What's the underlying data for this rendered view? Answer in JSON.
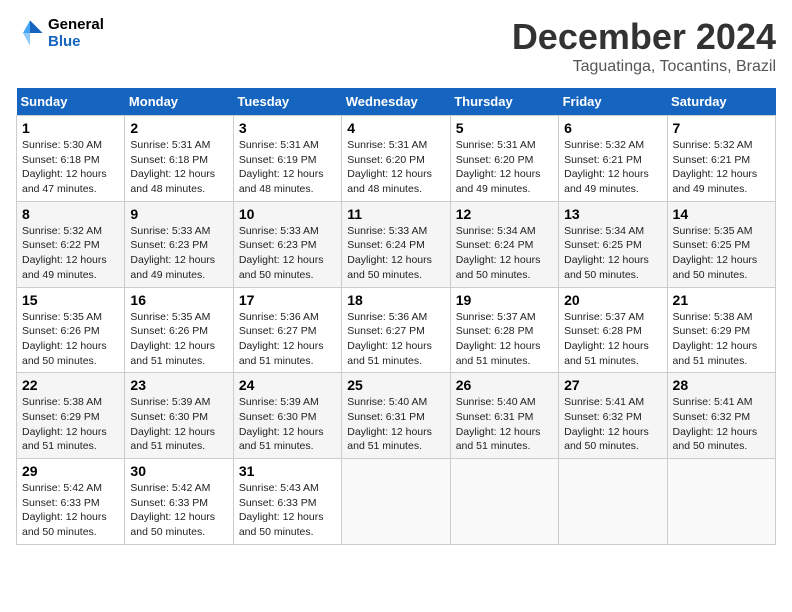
{
  "header": {
    "logo_line1": "General",
    "logo_line2": "Blue",
    "month": "December 2024",
    "location": "Taguatinga, Tocantins, Brazil"
  },
  "weekdays": [
    "Sunday",
    "Monday",
    "Tuesday",
    "Wednesday",
    "Thursday",
    "Friday",
    "Saturday"
  ],
  "weeks": [
    [
      {
        "day": "1",
        "sunrise": "Sunrise: 5:30 AM",
        "sunset": "Sunset: 6:18 PM",
        "daylight": "Daylight: 12 hours and 47 minutes."
      },
      {
        "day": "2",
        "sunrise": "Sunrise: 5:31 AM",
        "sunset": "Sunset: 6:18 PM",
        "daylight": "Daylight: 12 hours and 48 minutes."
      },
      {
        "day": "3",
        "sunrise": "Sunrise: 5:31 AM",
        "sunset": "Sunset: 6:19 PM",
        "daylight": "Daylight: 12 hours and 48 minutes."
      },
      {
        "day": "4",
        "sunrise": "Sunrise: 5:31 AM",
        "sunset": "Sunset: 6:20 PM",
        "daylight": "Daylight: 12 hours and 48 minutes."
      },
      {
        "day": "5",
        "sunrise": "Sunrise: 5:31 AM",
        "sunset": "Sunset: 6:20 PM",
        "daylight": "Daylight: 12 hours and 49 minutes."
      },
      {
        "day": "6",
        "sunrise": "Sunrise: 5:32 AM",
        "sunset": "Sunset: 6:21 PM",
        "daylight": "Daylight: 12 hours and 49 minutes."
      },
      {
        "day": "7",
        "sunrise": "Sunrise: 5:32 AM",
        "sunset": "Sunset: 6:21 PM",
        "daylight": "Daylight: 12 hours and 49 minutes."
      }
    ],
    [
      {
        "day": "8",
        "sunrise": "Sunrise: 5:32 AM",
        "sunset": "Sunset: 6:22 PM",
        "daylight": "Daylight: 12 hours and 49 minutes."
      },
      {
        "day": "9",
        "sunrise": "Sunrise: 5:33 AM",
        "sunset": "Sunset: 6:23 PM",
        "daylight": "Daylight: 12 hours and 49 minutes."
      },
      {
        "day": "10",
        "sunrise": "Sunrise: 5:33 AM",
        "sunset": "Sunset: 6:23 PM",
        "daylight": "Daylight: 12 hours and 50 minutes."
      },
      {
        "day": "11",
        "sunrise": "Sunrise: 5:33 AM",
        "sunset": "Sunset: 6:24 PM",
        "daylight": "Daylight: 12 hours and 50 minutes."
      },
      {
        "day": "12",
        "sunrise": "Sunrise: 5:34 AM",
        "sunset": "Sunset: 6:24 PM",
        "daylight": "Daylight: 12 hours and 50 minutes."
      },
      {
        "day": "13",
        "sunrise": "Sunrise: 5:34 AM",
        "sunset": "Sunset: 6:25 PM",
        "daylight": "Daylight: 12 hours and 50 minutes."
      },
      {
        "day": "14",
        "sunrise": "Sunrise: 5:35 AM",
        "sunset": "Sunset: 6:25 PM",
        "daylight": "Daylight: 12 hours and 50 minutes."
      }
    ],
    [
      {
        "day": "15",
        "sunrise": "Sunrise: 5:35 AM",
        "sunset": "Sunset: 6:26 PM",
        "daylight": "Daylight: 12 hours and 50 minutes."
      },
      {
        "day": "16",
        "sunrise": "Sunrise: 5:35 AM",
        "sunset": "Sunset: 6:26 PM",
        "daylight": "Daylight: 12 hours and 51 minutes."
      },
      {
        "day": "17",
        "sunrise": "Sunrise: 5:36 AM",
        "sunset": "Sunset: 6:27 PM",
        "daylight": "Daylight: 12 hours and 51 minutes."
      },
      {
        "day": "18",
        "sunrise": "Sunrise: 5:36 AM",
        "sunset": "Sunset: 6:27 PM",
        "daylight": "Daylight: 12 hours and 51 minutes."
      },
      {
        "day": "19",
        "sunrise": "Sunrise: 5:37 AM",
        "sunset": "Sunset: 6:28 PM",
        "daylight": "Daylight: 12 hours and 51 minutes."
      },
      {
        "day": "20",
        "sunrise": "Sunrise: 5:37 AM",
        "sunset": "Sunset: 6:28 PM",
        "daylight": "Daylight: 12 hours and 51 minutes."
      },
      {
        "day": "21",
        "sunrise": "Sunrise: 5:38 AM",
        "sunset": "Sunset: 6:29 PM",
        "daylight": "Daylight: 12 hours and 51 minutes."
      }
    ],
    [
      {
        "day": "22",
        "sunrise": "Sunrise: 5:38 AM",
        "sunset": "Sunset: 6:29 PM",
        "daylight": "Daylight: 12 hours and 51 minutes."
      },
      {
        "day": "23",
        "sunrise": "Sunrise: 5:39 AM",
        "sunset": "Sunset: 6:30 PM",
        "daylight": "Daylight: 12 hours and 51 minutes."
      },
      {
        "day": "24",
        "sunrise": "Sunrise: 5:39 AM",
        "sunset": "Sunset: 6:30 PM",
        "daylight": "Daylight: 12 hours and 51 minutes."
      },
      {
        "day": "25",
        "sunrise": "Sunrise: 5:40 AM",
        "sunset": "Sunset: 6:31 PM",
        "daylight": "Daylight: 12 hours and 51 minutes."
      },
      {
        "day": "26",
        "sunrise": "Sunrise: 5:40 AM",
        "sunset": "Sunset: 6:31 PM",
        "daylight": "Daylight: 12 hours and 51 minutes."
      },
      {
        "day": "27",
        "sunrise": "Sunrise: 5:41 AM",
        "sunset": "Sunset: 6:32 PM",
        "daylight": "Daylight: 12 hours and 50 minutes."
      },
      {
        "day": "28",
        "sunrise": "Sunrise: 5:41 AM",
        "sunset": "Sunset: 6:32 PM",
        "daylight": "Daylight: 12 hours and 50 minutes."
      }
    ],
    [
      {
        "day": "29",
        "sunrise": "Sunrise: 5:42 AM",
        "sunset": "Sunset: 6:33 PM",
        "daylight": "Daylight: 12 hours and 50 minutes."
      },
      {
        "day": "30",
        "sunrise": "Sunrise: 5:42 AM",
        "sunset": "Sunset: 6:33 PM",
        "daylight": "Daylight: 12 hours and 50 minutes."
      },
      {
        "day": "31",
        "sunrise": "Sunrise: 5:43 AM",
        "sunset": "Sunset: 6:33 PM",
        "daylight": "Daylight: 12 hours and 50 minutes."
      },
      null,
      null,
      null,
      null
    ]
  ]
}
